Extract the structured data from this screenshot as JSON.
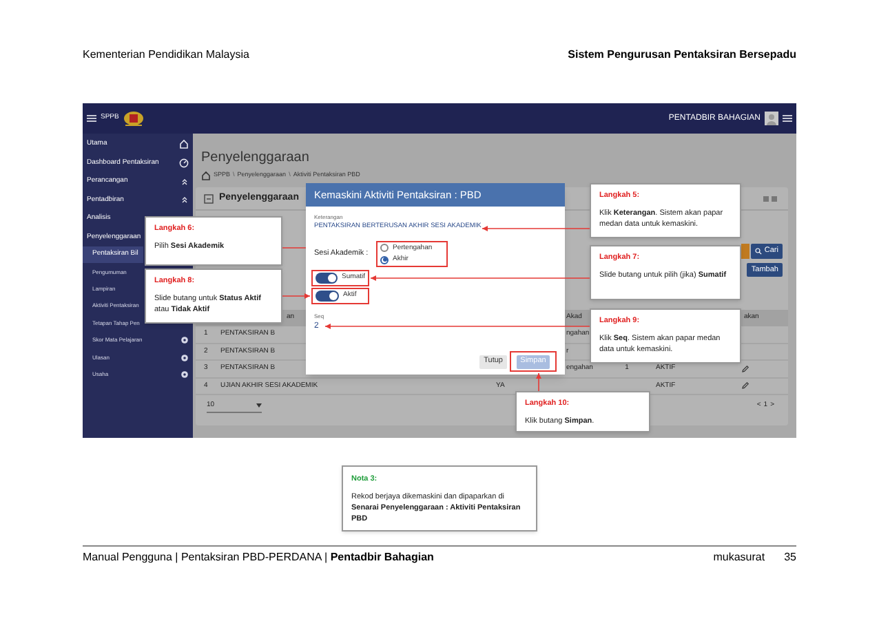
{
  "page_header": {
    "left": "Kementerian Pendidikan Malaysia",
    "right": "Sistem Pengurusan Pentaksiran Bersepadu"
  },
  "screenshot": {
    "top_bar": {
      "app_name": "SPPB",
      "user": "PENTADBIR BAHAGIAN"
    },
    "sidebar": {
      "items": [
        {
          "label": "Utama",
          "kind": "home",
          "selected": false
        },
        {
          "label": "Dashboard Pentaksiran",
          "kind": "gauge",
          "selected": false
        },
        {
          "label": "Perancangan",
          "kind": "chevrons",
          "selected": false
        },
        {
          "label": "Pentadbiran",
          "kind": "chevrons",
          "selected": false
        },
        {
          "label": "Analisis",
          "kind": "plain",
          "selected": false
        },
        {
          "label": "Penyelenggaraan",
          "kind": "plain",
          "selected": false,
          "children": [
            {
              "label": "Pentaksiran Bil",
              "kind": "plain",
              "selected": true
            },
            {
              "label": "Pengumuman",
              "kind": "plain",
              "selected": false
            },
            {
              "label": "Lampiran",
              "kind": "plain",
              "selected": false
            },
            {
              "label": "Aktiviti Pentaksiran",
              "kind": "plain",
              "selected": false
            },
            {
              "label": "Tetapan Tahap Pen",
              "kind": "plain",
              "selected": false
            },
            {
              "label": "Skor Mata Pelajaran",
              "kind": "gear",
              "selected": false
            },
            {
              "label": "Ulasan",
              "kind": "gear",
              "selected": false
            },
            {
              "label": "Usaha",
              "kind": "gear",
              "selected": false
            }
          ]
        }
      ]
    },
    "content": {
      "title": "Penyelenggaraan",
      "breadcrumb": [
        {
          "kind": "link",
          "text": "SPPB"
        },
        {
          "kind": "separator",
          "text": "\\"
        },
        {
          "kind": "link",
          "text": "Penyelenggaraan"
        },
        {
          "kind": "separator",
          "text": "\\"
        },
        {
          "kind": "link",
          "text": "Aktiviti Pentaksiran PBD"
        }
      ],
      "panel_title": "Penyelenggaraan",
      "search_button": "Cari",
      "add_button": "Tambah",
      "table": {
        "header": {
          "name": "an",
          "sesi": "Akad",
          "action": "akan"
        },
        "rows": [
          {
            "no": "1",
            "name": "PENTAKSIRAN B",
            "sesi": "ngahan"
          },
          {
            "no": "2",
            "name": "PENTAKSIRAN B",
            "sesi": "r"
          },
          {
            "no": "3",
            "name": "PENTAKSIRAN B",
            "sesi": "engahan",
            "seq": "1",
            "status": "AKTIF"
          },
          {
            "no": "4",
            "name": "UJIAN AKHIR SESI AKADEMIK",
            "flag": "YA",
            "status": "AKTIF"
          }
        ]
      },
      "page_size": "10",
      "pager": [
        "<",
        "1",
        ">"
      ]
    },
    "modal": {
      "title": "Kemaskini Aktiviti Pentaksiran : PBD",
      "description_label": "Keterangan",
      "description_value": "PENTAKSIRAN BERTERUSAN AKHIR SESI AKADEMIK",
      "session_label": "Sesi Akademik :",
      "session_options": [
        {
          "label": "Pertengahan",
          "selected": false
        },
        {
          "label": "Akhir",
          "selected": true
        }
      ],
      "toggles": [
        {
          "label": "Sumatif",
          "on": true
        },
        {
          "label": "Aktif",
          "on": true
        }
      ],
      "seq_label": "Seq",
      "seq_value": "2",
      "buttons": [
        {
          "label": "Tutup",
          "kind": "plain",
          "disabled": false
        },
        {
          "label": "Simpan",
          "kind": "primary",
          "disabled": true
        }
      ]
    }
  },
  "callouts": [
    {
      "kind": "step",
      "title": "Langkah 5:",
      "text": "Klik **Keterangan**. Sistem akan papar medan data untuk kemaskini."
    },
    {
      "kind": "step",
      "title": "Langkah 6:",
      "text": "Pilih **Sesi Akademik**"
    },
    {
      "kind": "step",
      "title": "Langkah 7:",
      "text": "Slide butang untuk pilih (jika) **Sumatif**"
    },
    {
      "kind": "step",
      "title": "Langkah 8:",
      "text": "Slide butang untuk **Status Aktif** atau **Tidak Aktif**"
    },
    {
      "kind": "step",
      "title": "Langkah 9:",
      "text": "Klik **Seq**. Sistem akan papar medan data untuk kemaskini."
    },
    {
      "kind": "step",
      "title": "Langkah 10:",
      "text": "Klik butang **Simpan**."
    }
  ],
  "note": {
    "kind": "note",
    "title": "Nota 3:",
    "text": "Rekod berjaya dikemaskini dan dipaparkan di **Senarai Penyelenggaraan : Aktiviti Pentaksiran PBD**"
  },
  "footer": {
    "left": "Manual Pengguna | Pentaksiran PBD-PERDANA | **Pentadbir Bahagian**",
    "page_label": "mukasurat",
    "page_number": "35"
  }
}
